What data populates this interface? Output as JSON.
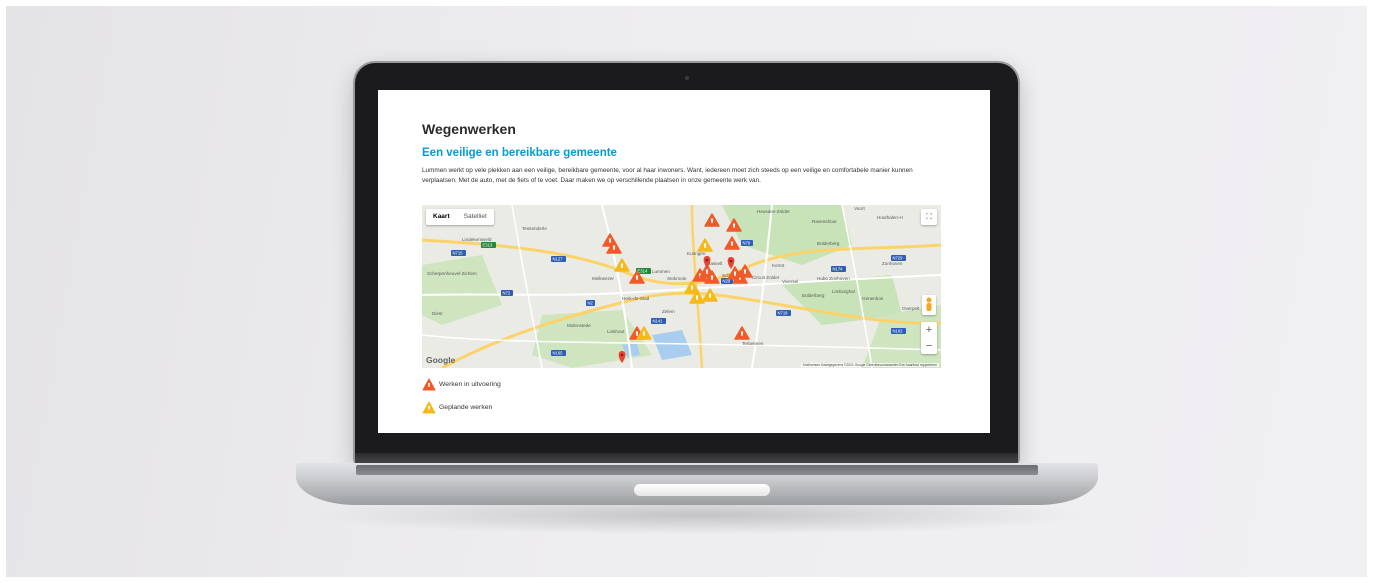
{
  "page": {
    "title": "Wegenwerken",
    "subtitle": "Een veilige en bereikbare gemeente",
    "intro": "Lummen werkt op vele plekken aan een veilige, bereikbare gemeente, voor al haar inwoners. Want, iedereen moet zich steeds op een veilige en comfortabele manier kunnen verplaatsen. Met de auto, met de fiets of te voet. Daar maken we op verschillende plaatsen in onze gemeente werk van."
  },
  "map": {
    "tabs": [
      {
        "label": "Kaart",
        "active": true
      },
      {
        "label": "Satelliet",
        "active": false
      }
    ],
    "zoom_in": "+",
    "zoom_out": "−",
    "fullscreen_icon": "⛶",
    "logo": "Google",
    "attribution": "Sneltoetsen   Kaartgegevens ©2021 Google   Gebruiksvoorwaarden   Een kaartfout rapporteren",
    "places": [
      "Heusden-Zolder",
      "Houthalen-H",
      "Voort",
      "Ravenshout",
      "Bolderberg",
      "Zonhoven",
      "Hasselt",
      "Lummen",
      "Herk-de-Stad",
      "Stokrooie",
      "Kuringen",
      "Schulen",
      "Lindekensveld",
      "Alsdonk",
      "Tessenderlo",
      "Melkwezer",
      "Zelem",
      "Linkhout",
      "Molenstede",
      "Scherpenheuvel-Zichem",
      "Diest",
      "Kermt",
      "Viversel",
      "Circuit Zolder",
      "Bolderberg",
      "Limburghal",
      "Hubo Zonhoven",
      "Overpelt",
      "Genenbos",
      "Terlaemen"
    ],
    "road_labels": [
      "E313",
      "E314",
      "N29",
      "N2",
      "N72",
      "N715",
      "N174",
      "N127",
      "N141",
      "N718",
      "N729",
      "N76",
      "N165",
      "N102"
    ],
    "markers_in_progress": 14,
    "markers_planned": 6,
    "markers_pin": 3
  },
  "legend": {
    "in_progress": "Werken in uitvoering",
    "planned": "Geplande werken"
  },
  "colors": {
    "accent": "#0a9ad3",
    "in_progress": "#f05a28",
    "planned": "#f5b91a",
    "pin": "#ea4335",
    "map_road_major": "#fcd36b",
    "map_green": "#b9dca6",
    "map_water": "#9bc8ee"
  }
}
